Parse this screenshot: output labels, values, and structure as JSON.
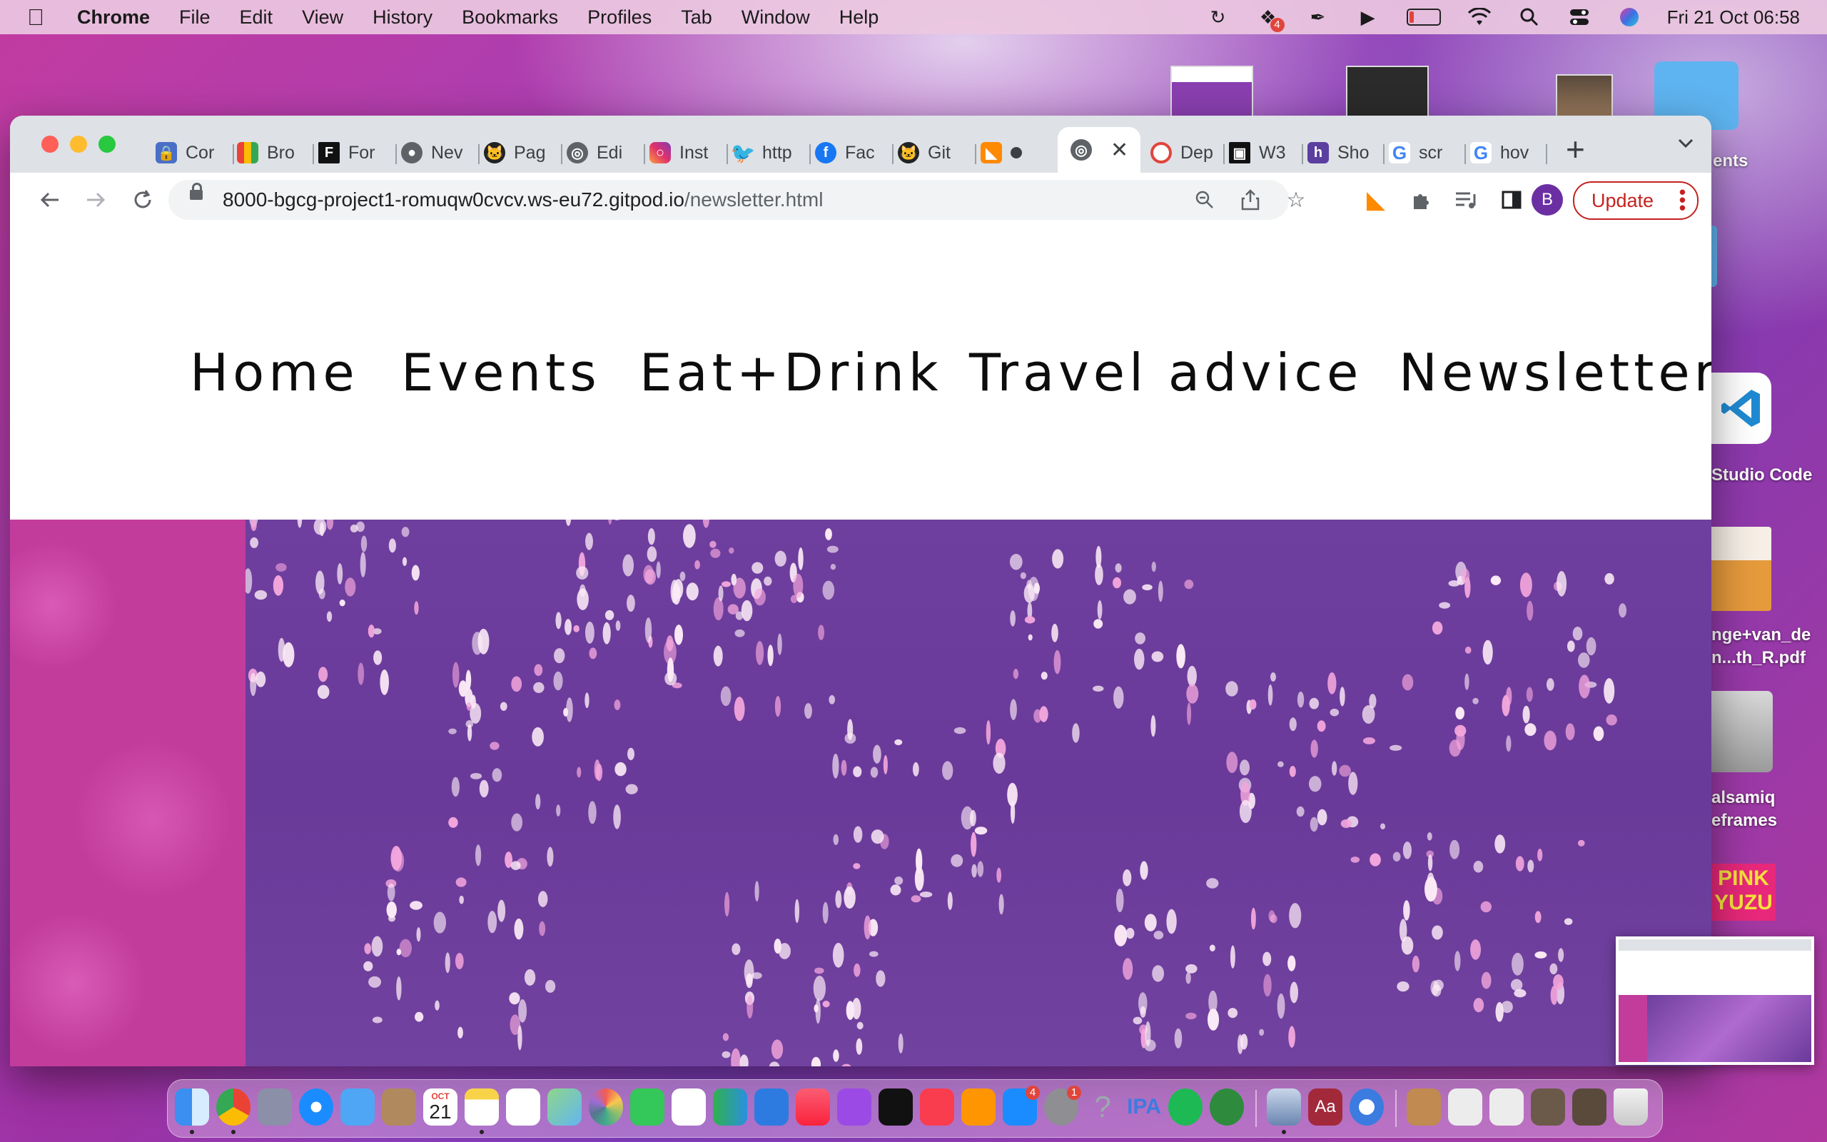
{
  "menubar": {
    "app_name": "Chrome",
    "menus": [
      "File",
      "Edit",
      "View",
      "History",
      "Bookmarks",
      "Profiles",
      "Tab",
      "Window",
      "Help"
    ],
    "dropbox_badge": "4",
    "clock": "Fri 21 Oct  06:58"
  },
  "desktop": {
    "labels": [
      "ents",
      "Studio Code",
      "nge+van_de",
      "n...th_R.pdf",
      "alsamiq",
      "eframes",
      "PINK",
      "YUZU"
    ]
  },
  "browser": {
    "tabs": [
      {
        "label": "Cor",
        "icon": "lock-icon"
      },
      {
        "label": "Bro",
        "icon": "slides-icon"
      },
      {
        "label": "For",
        "icon": "f-logo-icon"
      },
      {
        "label": "Nev",
        "icon": "chrome-icon"
      },
      {
        "label": "Pag",
        "icon": "github-icon"
      },
      {
        "label": "Edi",
        "icon": "globe-icon"
      },
      {
        "label": "Inst",
        "icon": "instagram-icon"
      },
      {
        "label": "http",
        "icon": "twitter-icon"
      },
      {
        "label": "Fac",
        "icon": "facebook-icon"
      },
      {
        "label": "Git",
        "icon": "github-icon"
      },
      {
        "label": "",
        "icon": "gitpod-icon"
      },
      {
        "label": "",
        "icon": "globe-icon",
        "active": true
      },
      {
        "label": "Dep",
        "icon": "opera-icon"
      },
      {
        "label": "W3",
        "icon": "w3-icon"
      },
      {
        "label": "Sho",
        "icon": "hub-icon"
      },
      {
        "label": "scr",
        "icon": "google-icon"
      },
      {
        "label": "hov",
        "icon": "google-icon"
      }
    ],
    "new_tab": "+",
    "url_host": "8000-bgcg-project1-romuqw0cvcv.ws-eu72.gitpod.io",
    "url_path": "/newsletter.html",
    "profile_initial": "B",
    "update_label": "Update"
  },
  "page": {
    "nav": [
      "Home",
      "Events",
      "Eat+Drink",
      "Travel advice",
      "Newsletter"
    ]
  },
  "dock": {
    "calendar_month": "OCT",
    "calendar_day": "21",
    "appstore_badge": "4",
    "settings_badge": "1",
    "ipa_label": "IPA",
    "dictionary_label": "Aa"
  }
}
